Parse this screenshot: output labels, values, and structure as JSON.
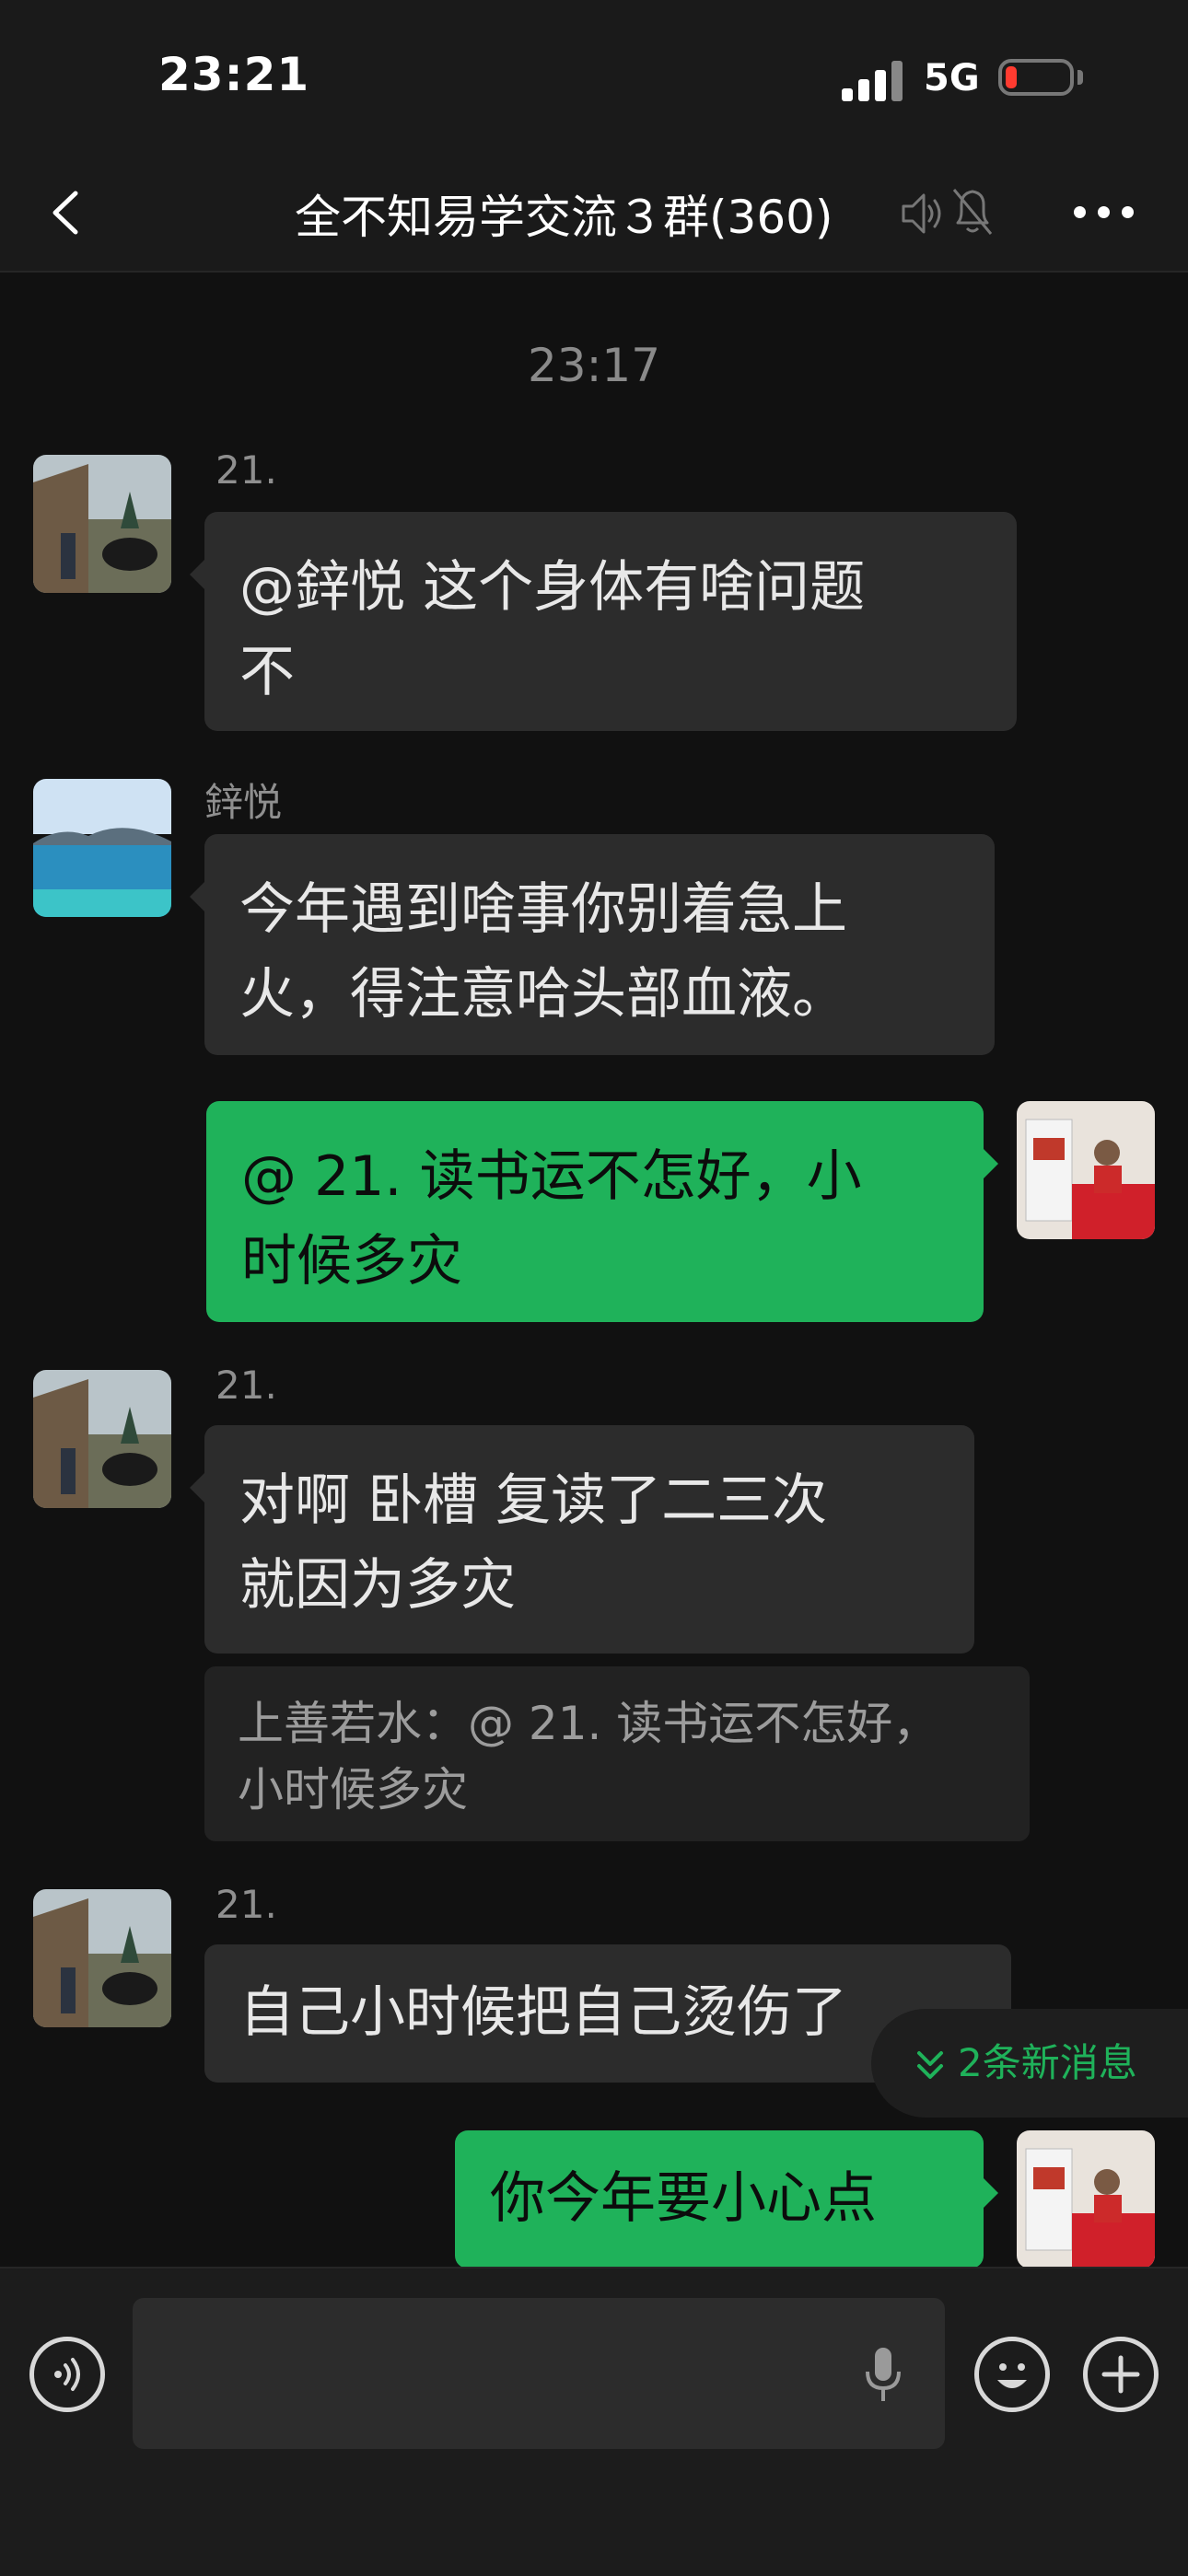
{
  "status_bar": {
    "time": "23:21",
    "network": "5G"
  },
  "header": {
    "title": "全不知易学交流３群(360)"
  },
  "chat": {
    "timestamp": "23:17",
    "messages": [
      {
        "sender": "21.",
        "text_lines": [
          "@鋅悦 这个身体有啥问题",
          "不"
        ]
      },
      {
        "sender": "鋅悦",
        "text_lines": [
          "今年遇到啥事你别着急上",
          "火，得注意哈头部血液。"
        ]
      },
      {
        "sender": "",
        "text_lines": [
          "@ 21. 读书运不怎好，小",
          "时候多灾"
        ]
      },
      {
        "sender": "21.",
        "text_lines": [
          "对啊 卧槽 复读了二三次",
          "就因为多灾"
        ],
        "quote_lines": [
          "上善若水：@ 21. 读书运不怎好，",
          "小时候多灾"
        ]
      },
      {
        "sender": "21.",
        "text_lines": [
          "自己小时候把自己烫伤了"
        ]
      },
      {
        "sender": "",
        "text_lines": [
          "你今年要小心点"
        ]
      }
    ]
  },
  "new_messages_label": "2条新消息",
  "input": {
    "value": ""
  },
  "icons": {
    "back": "chevron-left-icon",
    "voice_off": "speaker-off-icon",
    "mute": "bell-muted-icon",
    "more": "more-icon",
    "voice_input": "voice-input-icon",
    "mic": "microphone-icon",
    "emoji": "emoji-icon",
    "add": "plus-icon",
    "new_messages": "double-chevron-down-icon"
  },
  "colors": {
    "background": "#111111",
    "bubble_other": "#2c2c2c",
    "bubble_mine": "#1fb25a",
    "accent": "#1fb25a"
  }
}
